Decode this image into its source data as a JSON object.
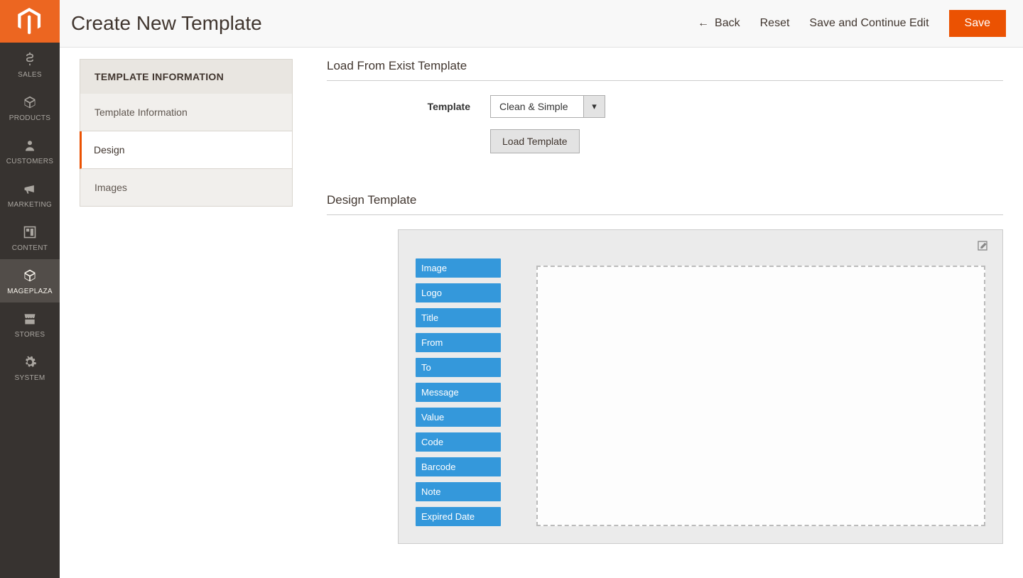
{
  "sidebar": {
    "items": [
      {
        "label": "SALES",
        "id": "sales"
      },
      {
        "label": "PRODUCTS",
        "id": "products"
      },
      {
        "label": "CUSTOMERS",
        "id": "customers"
      },
      {
        "label": "MARKETING",
        "id": "marketing"
      },
      {
        "label": "CONTENT",
        "id": "content"
      },
      {
        "label": "MAGEPLAZA",
        "id": "mageplaza"
      },
      {
        "label": "STORES",
        "id": "stores"
      },
      {
        "label": "SYSTEM",
        "id": "system"
      }
    ]
  },
  "header": {
    "title": "Create New Template",
    "back": "Back",
    "reset": "Reset",
    "save_continue": "Save and Continue Edit",
    "save": "Save"
  },
  "tabs": {
    "header": "TEMPLATE INFORMATION",
    "items": [
      {
        "label": "Template Information"
      },
      {
        "label": "Design"
      },
      {
        "label": "Images"
      }
    ],
    "active_index": 1
  },
  "load_section": {
    "title": "Load From Exist Template",
    "template_label": "Template",
    "template_value": "Clean & Simple",
    "load_button": "Load Template"
  },
  "design_section": {
    "title": "Design Template",
    "fields": [
      "Image",
      "Logo",
      "Title",
      "From",
      "To",
      "Message",
      "Value",
      "Code",
      "Barcode",
      "Note",
      "Expired Date"
    ]
  }
}
